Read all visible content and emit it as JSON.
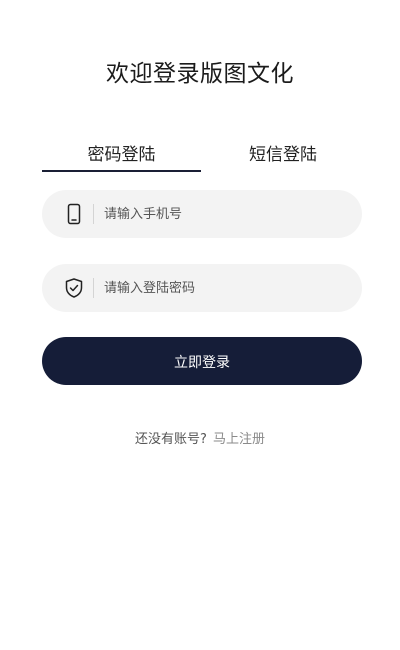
{
  "header": {
    "title": "欢迎登录版图文化"
  },
  "tabs": [
    {
      "label": "密码登陆",
      "active": true
    },
    {
      "label": "短信登陆",
      "active": false
    }
  ],
  "form": {
    "phone": {
      "placeholder": "请输入手机号",
      "value": "",
      "icon": "phone-icon"
    },
    "password": {
      "placeholder": "请输入登陆密码",
      "value": "",
      "icon": "shield-check-icon"
    },
    "submit_label": "立即登录"
  },
  "footer": {
    "prompt": "还没有账号?",
    "register_link": "马上注册"
  },
  "colors": {
    "primary": "#151d38",
    "field_background": "#f3f3f3"
  }
}
